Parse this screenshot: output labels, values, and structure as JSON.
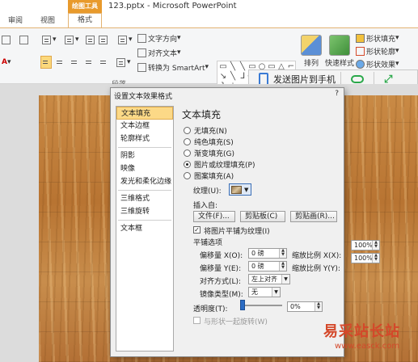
{
  "tabs": [
    {
      "label": "审阅"
    },
    {
      "label": "视图"
    }
  ],
  "context_tab": {
    "group": "绘图工具",
    "label": "格式"
  },
  "window_title": "123.pptx - Microsoft PowerPoint",
  "ribbon": {
    "text_direction": "文字方向",
    "align_text": "对齐文本",
    "convert_smartart": "转换为 SmartArt",
    "paragraph_group": "段落",
    "arrange": "排列",
    "quick_styles": "快速样式",
    "shape_fill": "形状填充",
    "shape_outline": "形状轮廓",
    "shape_effects": "形状效果",
    "shape_glyphs": [
      "▭",
      "╲",
      "╲",
      "▭",
      "○",
      "▭",
      "△",
      "⌐",
      "↘",
      "╲",
      "ᒧ",
      "⟶",
      "△",
      "╰",
      "ᘎ",
      "{",
      "}",
      "☆"
    ]
  },
  "send_bar": {
    "label": "发送图片到手机"
  },
  "dialog": {
    "title": "设置文本效果格式",
    "help": "?",
    "nav": [
      "文本填充",
      "文本边框",
      "轮廓样式",
      "阴影",
      "映像",
      "发光和柔化边缘",
      "三维格式",
      "三维旋转",
      "文本框"
    ],
    "panel_title": "文本填充",
    "fill_options": [
      {
        "label": "无填充(N)",
        "selected": false
      },
      {
        "label": "纯色填充(S)",
        "selected": false
      },
      {
        "label": "渐变填充(G)",
        "selected": false
      },
      {
        "label": "图片或纹理填充(P)",
        "selected": true
      },
      {
        "label": "图案填充(A)",
        "selected": false
      }
    ],
    "texture_label": "纹理(U):",
    "insert_from": "插入自:",
    "buttons": [
      "文件(F)...",
      "剪贴板(C)",
      "剪贴画(R)..."
    ],
    "tile_checkbox": "将图片平铺为纹理(I)",
    "tile_options_title": "平铺选项",
    "offset_x_label": "偏移量 X(O):",
    "offset_x_value": "0 磅",
    "scale_x_label": "缩放比例 X(X):",
    "scale_x_value": "100%",
    "offset_y_label": "偏移量 Y(E):",
    "offset_y_value": "0 磅",
    "scale_y_label": "缩放比例 Y(Y):",
    "scale_y_value": "100%",
    "alignment_label": "对齐方式(L):",
    "alignment_value": "左上对齐",
    "mirror_label": "镜像类型(M):",
    "mirror_value": "无",
    "transparency_label": "透明度(T):",
    "transparency_value": "0%",
    "rotate_label": "与形状一起旋转(W)"
  },
  "watermark": {
    "name": "易采站长站",
    "url": "www.easck.com"
  }
}
